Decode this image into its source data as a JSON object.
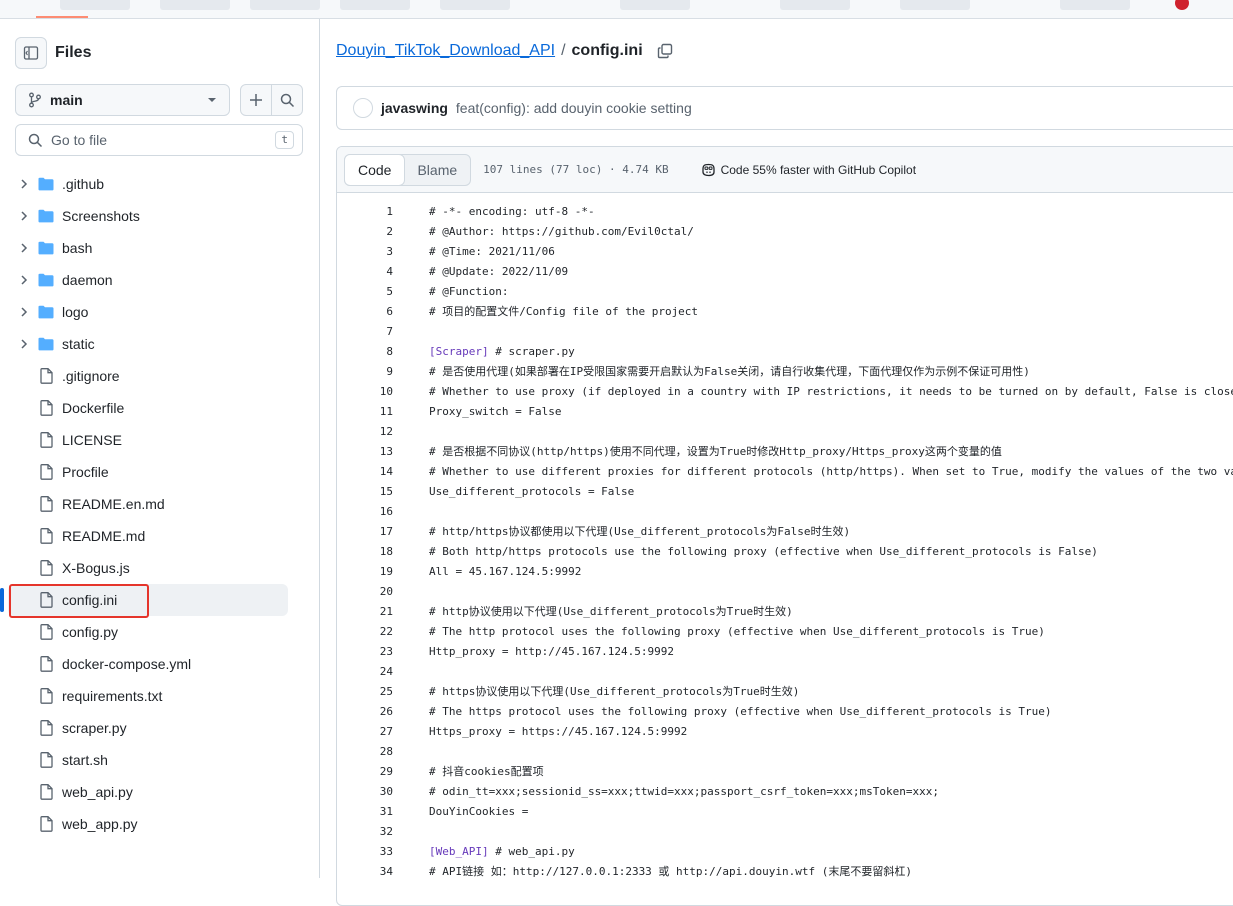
{
  "sidebar": {
    "title": "Files",
    "branch": "main",
    "search_placeholder": "Go to file",
    "search_shortcut": "t",
    "tree": [
      {
        "type": "folder",
        "name": ".github"
      },
      {
        "type": "folder",
        "name": "Screenshots"
      },
      {
        "type": "folder",
        "name": "bash"
      },
      {
        "type": "folder",
        "name": "daemon"
      },
      {
        "type": "folder",
        "name": "logo"
      },
      {
        "type": "folder",
        "name": "static"
      },
      {
        "type": "file",
        "name": ".gitignore"
      },
      {
        "type": "file",
        "name": "Dockerfile"
      },
      {
        "type": "file",
        "name": "LICENSE"
      },
      {
        "type": "file",
        "name": "Procfile"
      },
      {
        "type": "file",
        "name": "README.en.md"
      },
      {
        "type": "file",
        "name": "README.md"
      },
      {
        "type": "file",
        "name": "X-Bogus.js"
      },
      {
        "type": "file",
        "name": "config.ini",
        "active": true
      },
      {
        "type": "file",
        "name": "config.py"
      },
      {
        "type": "file",
        "name": "docker-compose.yml"
      },
      {
        "type": "file",
        "name": "requirements.txt"
      },
      {
        "type": "file",
        "name": "scraper.py"
      },
      {
        "type": "file",
        "name": "start.sh"
      },
      {
        "type": "file",
        "name": "web_api.py"
      },
      {
        "type": "file",
        "name": "web_app.py"
      }
    ]
  },
  "breadcrumb": {
    "repo": "Douyin_TikTok_Download_API",
    "separator": "/",
    "file": "config.ini"
  },
  "commit": {
    "author": "javaswing",
    "message": "feat(config): add douyin cookie setting"
  },
  "code_header": {
    "tab_code": "Code",
    "tab_blame": "Blame",
    "meta": "107 lines (77 loc) · 4.74 KB",
    "copilot": "Code 55% faster with GitHub Copilot"
  },
  "code_lines": [
    "# -*- encoding: utf-8 -*-",
    "# @Author: https://github.com/Evil0ctal/",
    "# @Time: 2021/11/06",
    "# @Update: 2022/11/09",
    "# @Function:",
    "# 项目的配置文件/Config file of the project",
    "",
    "[Scraper] # scraper.py",
    "# 是否使用代理(如果部署在IP受限国家需要开启默认为False关闭，请自行收集代理，下面代理仅作为示例不保证可用性)",
    "# Whether to use proxy (if deployed in a country with IP restrictions, it needs to be turned on by default, False is close",
    "Proxy_switch = False",
    "",
    "# 是否根据不同协议(http/https)使用不同代理，设置为True时修改Http_proxy/Https_proxy这两个变量的值",
    "# Whether to use different proxies for different protocols (http/https). When set to True, modify the values of the two va",
    "Use_different_protocols = False",
    "",
    "# http/https协议都使用以下代理(Use_different_protocols为False时生效)",
    "# Both http/https protocols use the following proxy (effective when Use_different_protocols is False)",
    "All = 45.167.124.5:9992",
    "",
    "# http协议使用以下代理(Use_different_protocols为True时生效)",
    "# The http protocol uses the following proxy (effective when Use_different_protocols is True)",
    "Http_proxy = http://45.167.124.5:9992",
    "",
    "# https协议使用以下代理(Use_different_protocols为True时生效)",
    "# The https protocol uses the following proxy (effective when Use_different_protocols is True)",
    "Https_proxy = https://45.167.124.5:9992",
    "",
    "# 抖音cookies配置项",
    "# odin_tt=xxx;sessionid_ss=xxx;ttwid=xxx;passport_csrf_token=xxx;msToken=xxx;",
    "DouYinCookies =",
    "",
    "[Web_API] # web_api.py",
    "# API链接 如：http://127.0.0.1:2333 或 http://api.douyin.wtf (末尾不要留斜杠)"
  ],
  "colors": {
    "link": "#0969da",
    "section": "#6639ba",
    "highlight": "#e5352b",
    "folder": "#54aeff"
  }
}
